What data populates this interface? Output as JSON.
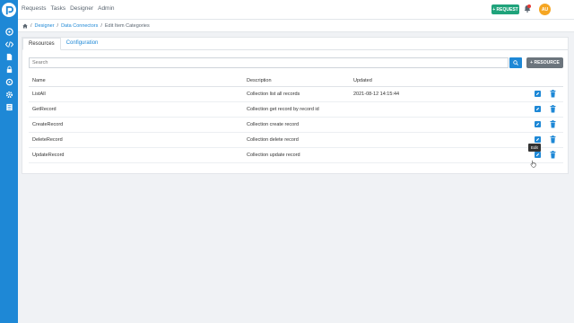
{
  "topnav": {
    "items": [
      "Requests",
      "Tasks",
      "Designer",
      "Admin"
    ]
  },
  "header": {
    "request_button": "+ REQUEST",
    "avatar_initials": "AU"
  },
  "breadcrumb": {
    "designer": "Designer",
    "data_connectors": "Data Connectors",
    "current": "Edit Item Categories"
  },
  "tabs": {
    "resources": "Resources",
    "configuration": "Configuration"
  },
  "search": {
    "placeholder": "Search"
  },
  "resource_button": "+ RESOURCE",
  "table": {
    "headers": {
      "name": "Name",
      "description": "Description",
      "updated": "Updated"
    },
    "rows": [
      {
        "name": "ListAll",
        "description": "Collection list all records",
        "updated": "2021-08-12 14:15:44"
      },
      {
        "name": "GetRecord",
        "description": "Collection get record by record id",
        "updated": ""
      },
      {
        "name": "CreateRecord",
        "description": "Collection create record",
        "updated": ""
      },
      {
        "name": "DeleteRecord",
        "description": "Collection delete record",
        "updated": ""
      },
      {
        "name": "UpdateRecord",
        "description": "Collection update record",
        "updated": ""
      }
    ]
  },
  "tooltip": "Edit",
  "colors": {
    "sidebar": "#1e88d6",
    "accent": "#1e88d6",
    "request_button": "#1fa37b",
    "avatar": "#f5a623"
  }
}
